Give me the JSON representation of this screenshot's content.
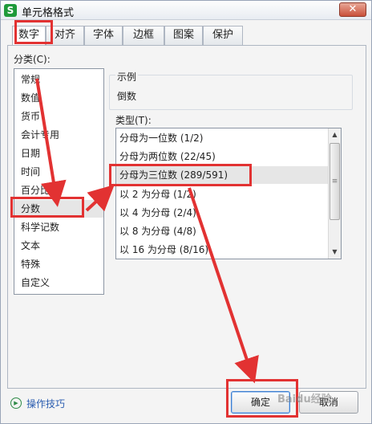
{
  "window": {
    "title": "单元格格式",
    "app_icon": "S",
    "close_glyph": "✕"
  },
  "tabs": [
    {
      "label": "数字",
      "active": true
    },
    {
      "label": "对齐"
    },
    {
      "label": "字体"
    },
    {
      "label": "边框"
    },
    {
      "label": "图案"
    },
    {
      "label": "保护"
    }
  ],
  "category": {
    "label": "分类(C):",
    "items": [
      "常规",
      "数值",
      "货币",
      "会计专用",
      "日期",
      "时间",
      "百分比",
      "分数",
      "科学记数",
      "文本",
      "特殊",
      "自定义"
    ],
    "selected": "分数"
  },
  "preview": {
    "label": "示例",
    "value": "倒数"
  },
  "type": {
    "label": "类型(T):",
    "items": [
      "分母为一位数 (1/2)",
      "分母为两位数 (22/45)",
      "分母为三位数 (289/591)",
      "以 2 为分母 (1/2)",
      "以 4 为分母 (2/4)",
      "以 8 为分母 (4/8)",
      "以 16 为分母 (8/16)"
    ],
    "selected": "分母为三位数 (289/591)"
  },
  "footer": {
    "help_label": "操作技巧",
    "ok_label": "确定",
    "cancel_label": "取消"
  },
  "colors": {
    "annotation": "#e23232",
    "link": "#2a5db0"
  },
  "watermark": "Baidu经验"
}
